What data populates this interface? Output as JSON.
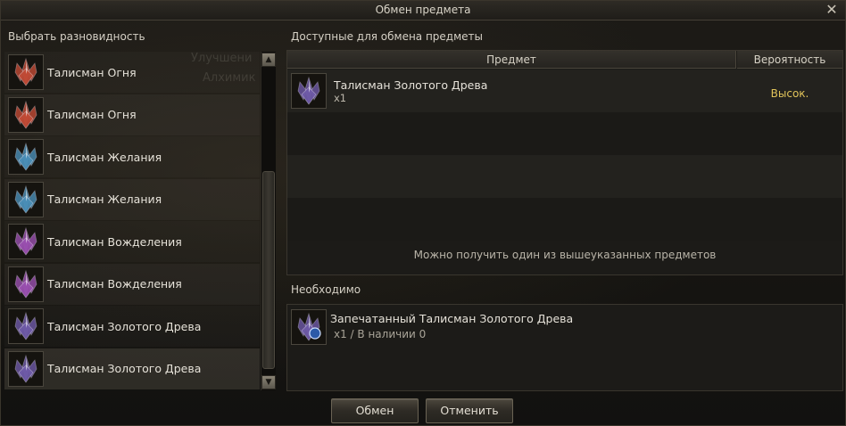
{
  "window": {
    "title": "Обмен предмета"
  },
  "left": {
    "header": "Выбрать разновидность",
    "items": [
      {
        "name": "Талисман Огня",
        "color": "#c24a35"
      },
      {
        "name": "Талисман Огня",
        "color": "#c24a35"
      },
      {
        "name": "Талисман Желания",
        "color": "#4a8fb8"
      },
      {
        "name": "Талисман Желания",
        "color": "#4a8fb8"
      },
      {
        "name": "Талисман Вожделения",
        "color": "#9a4fb0"
      },
      {
        "name": "Талисман Вожделения",
        "color": "#9a4fb0"
      },
      {
        "name": "Талисман Золотого Древа",
        "color": "#6e5aa8"
      },
      {
        "name": "Талисман Золотого Древа",
        "color": "#6e5aa8"
      }
    ]
  },
  "background_ghost": {
    "line1": "Улучшени",
    "line2": "Алхимик"
  },
  "available": {
    "header": "Доступные для обмена предметы",
    "col_item": "Предмет",
    "col_prob": "Вероятность",
    "rows": [
      {
        "name": "Талисман Золотого Древа",
        "qty": "x1",
        "prob": "Высок.",
        "color": "#6e5aa8"
      }
    ],
    "note": "Можно получить один из вышеуказанных предметов"
  },
  "required": {
    "header": "Необходимо",
    "name": "Запечатанный Талисман Золотого Древа",
    "qty": "x1 / В наличии 0",
    "color": "#6e5aa8"
  },
  "buttons": {
    "exchange": "Обмен",
    "cancel": "Отменить"
  },
  "colors": {
    "accent_gold": "#e0c35a"
  }
}
